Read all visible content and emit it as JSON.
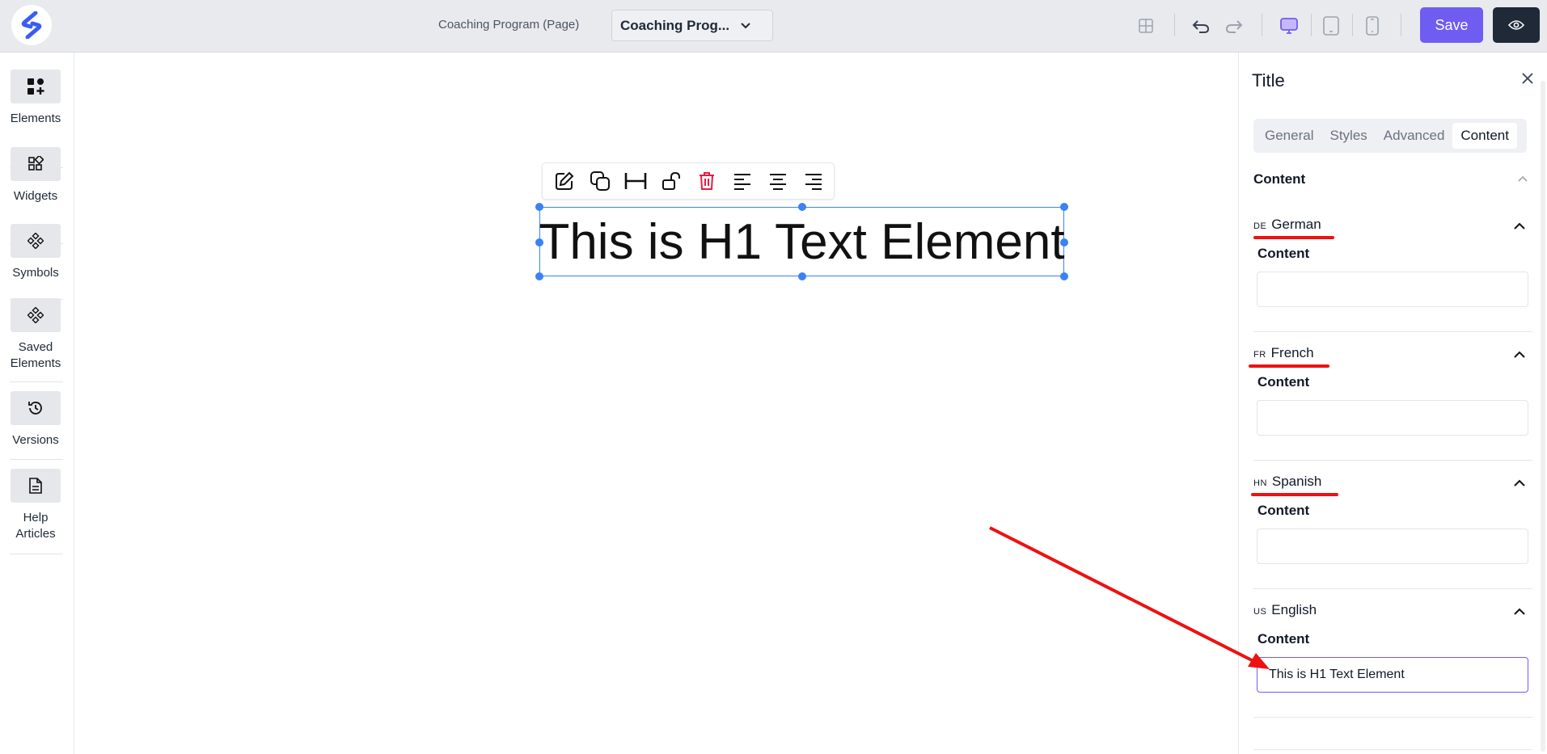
{
  "header": {
    "page_label": "Coaching Program (Page)",
    "page_select_value": "Coaching Prog...",
    "save_label": "Save",
    "colors": {
      "accent": "#6f5df1",
      "dark": "#1f2937",
      "selection": "#3b82f6",
      "annotation": "#ee1111"
    }
  },
  "sidebar": {
    "items": [
      {
        "label": "Elements",
        "icon": "elements-icon"
      },
      {
        "label": "Widgets",
        "icon": "widgets-icon"
      },
      {
        "label": "Symbols",
        "icon": "symbols-icon"
      },
      {
        "label": "Saved Elements",
        "icon": "saved-elements-icon"
      },
      {
        "label": "Versions",
        "icon": "history-icon"
      },
      {
        "label": "Help Articles",
        "icon": "document-icon"
      }
    ]
  },
  "canvas": {
    "heading_text": "This is H1 Text Element",
    "toolbar_tools": [
      "edit-icon",
      "duplicate-icon",
      "width-icon",
      "unlock-icon",
      "delete-icon",
      "align-left-icon",
      "align-center-icon",
      "align-right-icon"
    ]
  },
  "panel": {
    "title": "Title",
    "tabs": [
      "General",
      "Styles",
      "Advanced",
      "Content"
    ],
    "active_tab": "Content",
    "section_title": "Content",
    "languages": [
      {
        "code": "DE",
        "name": "German",
        "content_label": "Content",
        "value": ""
      },
      {
        "code": "FR",
        "name": "French",
        "content_label": "Content",
        "value": ""
      },
      {
        "code": "HN",
        "name": "Spanish",
        "content_label": "Content",
        "value": ""
      },
      {
        "code": "US",
        "name": "English",
        "content_label": "Content",
        "value": "This is H1 Text Element"
      }
    ]
  }
}
